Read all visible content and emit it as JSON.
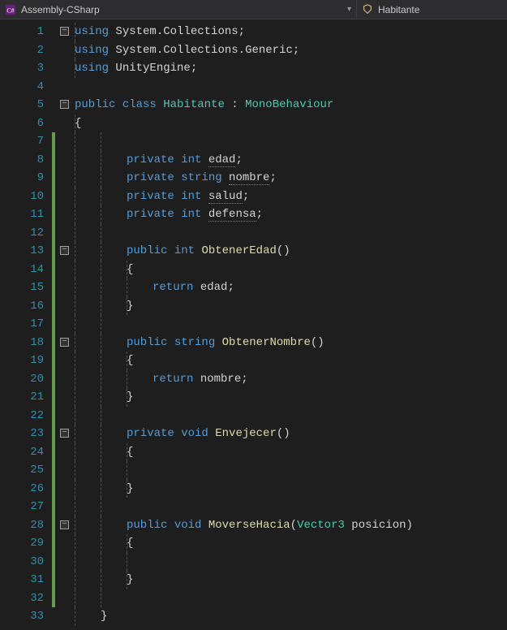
{
  "topbar": {
    "file_dropdown": "Assembly-CSharp",
    "class_dropdown": "Habitante"
  },
  "code": {
    "lines": [
      {
        "n": 1,
        "fold": true,
        "bar": false,
        "g": [
          0
        ],
        "tokens": [
          [
            "kw",
            "using"
          ],
          [
            "punc",
            " "
          ],
          [
            "ident",
            "System"
          ],
          [
            "punc",
            "."
          ],
          [
            "ident",
            "Collections"
          ],
          [
            "punc",
            ";"
          ]
        ]
      },
      {
        "n": 2,
        "fold": false,
        "bar": false,
        "g": [
          0
        ],
        "tokens": [
          [
            "kw",
            "using"
          ],
          [
            "punc",
            " "
          ],
          [
            "ident",
            "System"
          ],
          [
            "punc",
            "."
          ],
          [
            "ident",
            "Collections"
          ],
          [
            "punc",
            "."
          ],
          [
            "ident",
            "Generic"
          ],
          [
            "punc",
            ";"
          ]
        ]
      },
      {
        "n": 3,
        "fold": false,
        "bar": false,
        "g": [
          0
        ],
        "tokens": [
          [
            "kw",
            "using"
          ],
          [
            "punc",
            " "
          ],
          [
            "ident",
            "UnityEngine"
          ],
          [
            "punc",
            ";"
          ]
        ]
      },
      {
        "n": 4,
        "fold": false,
        "bar": false,
        "g": [],
        "tokens": []
      },
      {
        "n": 5,
        "fold": true,
        "bar": false,
        "g": [],
        "tokens": [
          [
            "kw",
            "public"
          ],
          [
            "punc",
            " "
          ],
          [
            "kw",
            "class"
          ],
          [
            "punc",
            " "
          ],
          [
            "type",
            "Habitante"
          ],
          [
            "punc",
            " : "
          ],
          [
            "type",
            "MonoBehaviour"
          ]
        ]
      },
      {
        "n": 6,
        "fold": false,
        "bar": false,
        "g": [
          0
        ],
        "tokens": [
          [
            "punc",
            "{"
          ]
        ]
      },
      {
        "n": 7,
        "fold": false,
        "bar": true,
        "g": [
          0,
          1
        ],
        "tokens": []
      },
      {
        "n": 8,
        "fold": false,
        "bar": true,
        "g": [
          0,
          1
        ],
        "indent": 2,
        "tokens": [
          [
            "kw",
            "private"
          ],
          [
            "punc",
            " "
          ],
          [
            "kw",
            "int"
          ],
          [
            "punc",
            " "
          ],
          [
            "field dots",
            "edad"
          ],
          [
            "punc",
            ";"
          ]
        ]
      },
      {
        "n": 9,
        "fold": false,
        "bar": true,
        "g": [
          0,
          1
        ],
        "indent": 2,
        "tokens": [
          [
            "kw",
            "private"
          ],
          [
            "punc",
            " "
          ],
          [
            "kw",
            "string"
          ],
          [
            "punc",
            " "
          ],
          [
            "field dots",
            "nombre"
          ],
          [
            "punc",
            ";"
          ]
        ]
      },
      {
        "n": 10,
        "fold": false,
        "bar": true,
        "g": [
          0,
          1
        ],
        "indent": 2,
        "tokens": [
          [
            "kw",
            "private"
          ],
          [
            "punc",
            " "
          ],
          [
            "kw",
            "int"
          ],
          [
            "punc",
            " "
          ],
          [
            "field dots",
            "salud"
          ],
          [
            "punc",
            ";"
          ]
        ]
      },
      {
        "n": 11,
        "fold": false,
        "bar": true,
        "g": [
          0,
          1
        ],
        "indent": 2,
        "tokens": [
          [
            "kw",
            "private"
          ],
          [
            "punc",
            " "
          ],
          [
            "kw",
            "int"
          ],
          [
            "punc",
            " "
          ],
          [
            "field dots",
            "defensa"
          ],
          [
            "punc",
            ";"
          ]
        ]
      },
      {
        "n": 12,
        "fold": false,
        "bar": true,
        "g": [
          0,
          1
        ],
        "tokens": []
      },
      {
        "n": 13,
        "fold": true,
        "bar": true,
        "g": [
          0,
          1
        ],
        "indent": 2,
        "tokens": [
          [
            "kw",
            "public"
          ],
          [
            "punc",
            " "
          ],
          [
            "kw",
            "int"
          ],
          [
            "punc",
            " "
          ],
          [
            "method",
            "ObtenerEdad"
          ],
          [
            "punc",
            "()"
          ]
        ]
      },
      {
        "n": 14,
        "fold": false,
        "bar": true,
        "g": [
          0,
          1,
          2
        ],
        "indent": 2,
        "tokens": [
          [
            "punc",
            "{"
          ]
        ]
      },
      {
        "n": 15,
        "fold": false,
        "bar": true,
        "g": [
          0,
          1,
          2
        ],
        "indent": 3,
        "tokens": [
          [
            "kw",
            "return"
          ],
          [
            "punc",
            " "
          ],
          [
            "field",
            "edad"
          ],
          [
            "punc",
            ";"
          ]
        ]
      },
      {
        "n": 16,
        "fold": false,
        "bar": true,
        "g": [
          0,
          1,
          2
        ],
        "indent": 2,
        "tokens": [
          [
            "punc",
            "}"
          ]
        ]
      },
      {
        "n": 17,
        "fold": false,
        "bar": true,
        "g": [
          0,
          1
        ],
        "tokens": []
      },
      {
        "n": 18,
        "fold": true,
        "bar": true,
        "g": [
          0,
          1
        ],
        "indent": 2,
        "tokens": [
          [
            "kw",
            "public"
          ],
          [
            "punc",
            " "
          ],
          [
            "kw",
            "string"
          ],
          [
            "punc",
            " "
          ],
          [
            "method",
            "ObtenerNombre"
          ],
          [
            "punc",
            "()"
          ]
        ]
      },
      {
        "n": 19,
        "fold": false,
        "bar": true,
        "g": [
          0,
          1,
          2
        ],
        "indent": 2,
        "tokens": [
          [
            "punc",
            "{"
          ]
        ]
      },
      {
        "n": 20,
        "fold": false,
        "bar": true,
        "g": [
          0,
          1,
          2
        ],
        "indent": 3,
        "tokens": [
          [
            "kw",
            "return"
          ],
          [
            "punc",
            " "
          ],
          [
            "field",
            "nombre"
          ],
          [
            "punc",
            ";"
          ]
        ]
      },
      {
        "n": 21,
        "fold": false,
        "bar": true,
        "g": [
          0,
          1,
          2
        ],
        "indent": 2,
        "tokens": [
          [
            "punc",
            "}"
          ]
        ]
      },
      {
        "n": 22,
        "fold": false,
        "bar": true,
        "g": [
          0,
          1
        ],
        "tokens": []
      },
      {
        "n": 23,
        "fold": true,
        "bar": true,
        "g": [
          0,
          1
        ],
        "indent": 2,
        "tokens": [
          [
            "kw",
            "private"
          ],
          [
            "punc",
            " "
          ],
          [
            "kw",
            "void"
          ],
          [
            "punc",
            " "
          ],
          [
            "method",
            "Envejecer"
          ],
          [
            "punc",
            "()"
          ]
        ]
      },
      {
        "n": 24,
        "fold": false,
        "bar": true,
        "g": [
          0,
          1,
          2
        ],
        "indent": 2,
        "tokens": [
          [
            "punc",
            "{"
          ]
        ]
      },
      {
        "n": 25,
        "fold": false,
        "bar": true,
        "g": [
          0,
          1,
          2
        ],
        "indent": 3,
        "tokens": []
      },
      {
        "n": 26,
        "fold": false,
        "bar": true,
        "g": [
          0,
          1,
          2
        ],
        "indent": 2,
        "tokens": [
          [
            "punc",
            "}"
          ]
        ]
      },
      {
        "n": 27,
        "fold": false,
        "bar": true,
        "g": [
          0,
          1
        ],
        "tokens": []
      },
      {
        "n": 28,
        "fold": true,
        "bar": true,
        "g": [
          0,
          1
        ],
        "indent": 2,
        "tokens": [
          [
            "kw",
            "public"
          ],
          [
            "punc",
            " "
          ],
          [
            "kw",
            "void"
          ],
          [
            "punc",
            " "
          ],
          [
            "method",
            "MoverseHacia"
          ],
          [
            "punc",
            "("
          ],
          [
            "type",
            "Vector3"
          ],
          [
            "punc",
            " "
          ],
          [
            "ident",
            "posicion"
          ],
          [
            "punc",
            ")"
          ]
        ]
      },
      {
        "n": 29,
        "fold": false,
        "bar": true,
        "g": [
          0,
          1,
          2
        ],
        "indent": 2,
        "tokens": [
          [
            "punc",
            "{"
          ]
        ]
      },
      {
        "n": 30,
        "fold": false,
        "bar": true,
        "g": [
          0,
          1,
          2
        ],
        "indent": 3,
        "tokens": []
      },
      {
        "n": 31,
        "fold": false,
        "bar": true,
        "g": [
          0,
          1,
          2
        ],
        "indent": 2,
        "tokens": [
          [
            "punc",
            "}"
          ]
        ]
      },
      {
        "n": 32,
        "fold": false,
        "bar": true,
        "g": [
          0,
          1
        ],
        "tokens": []
      },
      {
        "n": 33,
        "fold": false,
        "bar": false,
        "g": [
          0
        ],
        "indent": 1,
        "tokens": [
          [
            "punc",
            "}"
          ]
        ]
      }
    ]
  }
}
